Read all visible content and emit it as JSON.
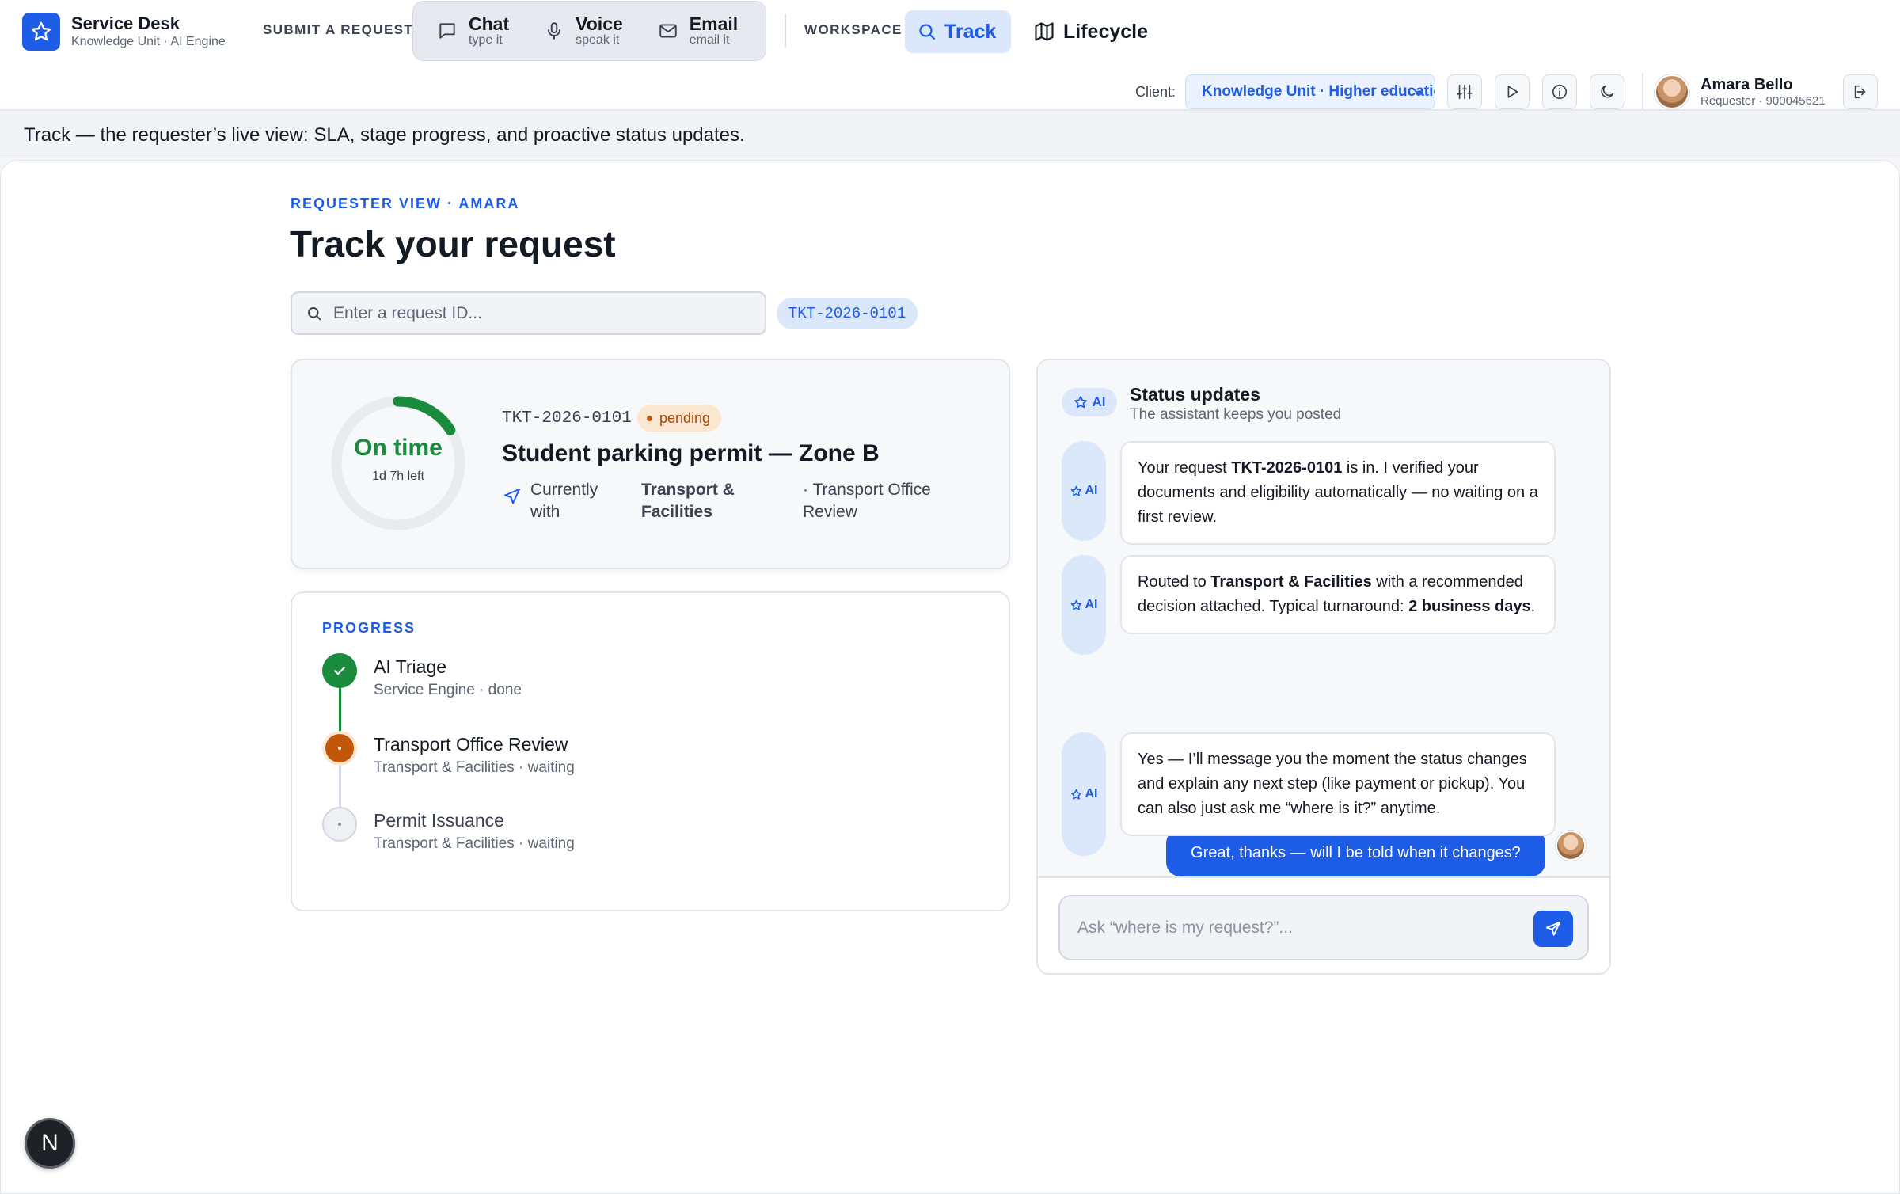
{
  "app": {
    "title": "Service Desk",
    "subtitle": "Knowledge Unit · AI Engine"
  },
  "nav": {
    "submit_label": "SUBMIT A REQUEST",
    "channels": [
      {
        "title": "Chat",
        "sub": "type it",
        "icon": "chat-bubble-icon"
      },
      {
        "title": "Voice",
        "sub": "speak it",
        "icon": "microphone-icon"
      },
      {
        "title": "Email",
        "sub": "email it",
        "icon": "mail-icon"
      }
    ],
    "workspace_label": "WORKSPACE",
    "track_label": "Track",
    "lifecycle_label": "Lifecycle"
  },
  "toolbar": {
    "client_label": "Client:",
    "client_value": "Knowledge Unit · Higher education",
    "tools": [
      "sliders-icon",
      "play-icon",
      "info-icon",
      "moon-icon"
    ]
  },
  "user": {
    "name": "Amara Bello",
    "sub": "Requester · 900045621"
  },
  "caption": "Track — the requester’s live view: SLA, stage progress, and proactive status updates.",
  "page": {
    "eyebrow": "REQUESTER VIEW · AMARA",
    "title": "Track your request",
    "search_placeholder": "Enter a request ID...",
    "ticket_chip": "TKT-2026-0101"
  },
  "status_card": {
    "sla_label": "On time",
    "sla_remaining": "1d 7h left",
    "sla_progress": 0.16,
    "ticket_id": "TKT-2026-0101",
    "status": "pending",
    "request_title": "Student parking permit — Zone B",
    "currently_with_label": "Currently with",
    "department": "Transport & Facilities",
    "stage": "· Transport Office Review"
  },
  "progress": {
    "title": "PROGRESS",
    "steps": [
      {
        "name": "AI Triage",
        "meta": "Service Engine · done",
        "state": "done"
      },
      {
        "name": "Transport Office Review",
        "meta": "Transport & Facilities · waiting",
        "state": "active"
      },
      {
        "name": "Permit Issuance",
        "meta": "Transport & Facilities · waiting",
        "state": "pending"
      }
    ]
  },
  "updates": {
    "badge": "AI",
    "title": "Status updates",
    "subtitle": "The assistant keeps you posted",
    "ai_tag": "AI",
    "messages": {
      "m1_a": "Your request ",
      "m1_b": "TKT-2026-0101",
      "m1_c": " is in. I verified your documents and eligibility automatically — no waiting on a first review.",
      "m2_a": "Routed to ",
      "m2_b": "Transport & Facilities",
      "m2_c": " with a recommended decision attached. Typical turnaround: ",
      "m2_d": "2 business days",
      "m2_e": ".",
      "user": "Great, thanks — will I be told when it changes?",
      "m3": "Yes — I’ll message you the moment the status changes and explain any next step (like payment or pickup). You can also just ask me “where is it?” anytime."
    },
    "ask_placeholder": "Ask “where is my request?”..."
  },
  "fab_label": "N",
  "colors": {
    "accent": "#1d5ce6",
    "success": "#1a8a3c",
    "warning": "#c2570a"
  }
}
